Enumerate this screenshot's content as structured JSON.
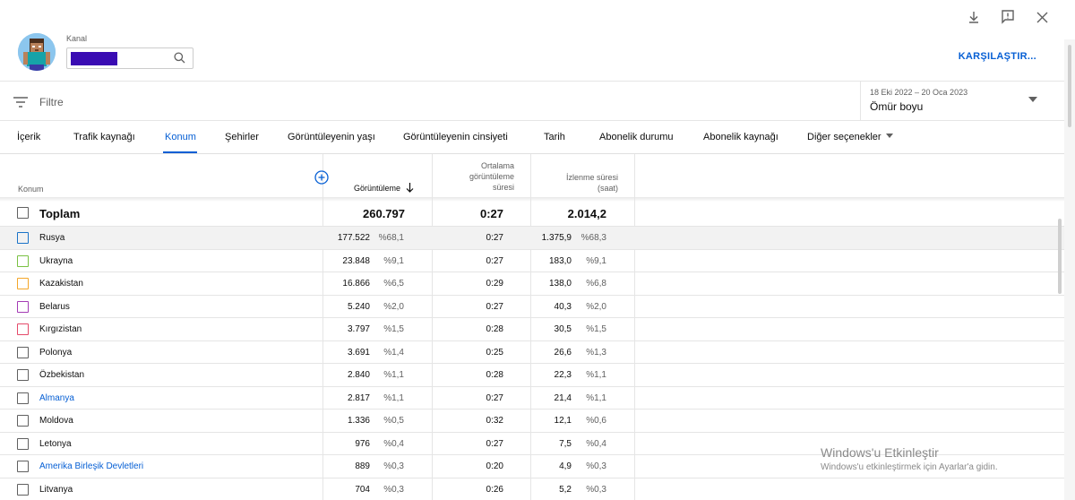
{
  "header": {
    "channel_label": "Kanal",
    "compare_button": "KARŞILAŞTIR...",
    "icons": [
      "download-icon",
      "feedback-icon",
      "close-icon"
    ]
  },
  "filter": {
    "placeholder": "Filtre",
    "date_range": "18 Eki 2022 – 20 Oca 2023",
    "period": "Ömür boyu"
  },
  "tabs": {
    "items": [
      "İçerik",
      "Trafik kaynağı",
      "Konum",
      "Şehirler",
      "Görüntüleyenin yaşı",
      "Görüntüleyenin cinsiyeti",
      "Tarih",
      "Abonelik durumu",
      "Abonelik kaynağı",
      "Diğer seçenekler"
    ],
    "active": "Konum"
  },
  "table": {
    "headers": {
      "location": "Konum",
      "views": "Görüntüleme",
      "avg_1": "Ortalama",
      "avg_2": "görüntüleme",
      "avg_3": "süresi",
      "watch_1": "İzlenme süresi",
      "watch_2": "(saat)"
    },
    "total": {
      "label": "Toplam",
      "views": "260.797",
      "avg": "0:27",
      "watch": "2.014,2"
    },
    "rows": [
      {
        "name": "Rusya",
        "views": "177.522",
        "views_pct": "%68,1",
        "avg": "0:27",
        "watch": "1.375,9",
        "watch_pct": "%68,3",
        "color": "#1a73c8"
      },
      {
        "name": "Ukrayna",
        "views": "23.848",
        "views_pct": "%9,1",
        "avg": "0:27",
        "watch": "183,0",
        "watch_pct": "%9,1",
        "color": "#79c142"
      },
      {
        "name": "Kazakistan",
        "views": "16.866",
        "views_pct": "%6,5",
        "avg": "0:29",
        "watch": "138,0",
        "watch_pct": "%6,8",
        "color": "#f4a629"
      },
      {
        "name": "Belarus",
        "views": "5.240",
        "views_pct": "%2,0",
        "avg": "0:27",
        "watch": "40,3",
        "watch_pct": "%2,0",
        "color": "#a43bb4"
      },
      {
        "name": "Kırgızistan",
        "views": "3.797",
        "views_pct": "%1,5",
        "avg": "0:28",
        "watch": "30,5",
        "watch_pct": "%1,5",
        "color": "#e44a6a"
      },
      {
        "name": "Polonya",
        "views": "3.691",
        "views_pct": "%1,4",
        "avg": "0:25",
        "watch": "26,6",
        "watch_pct": "%1,3",
        "color": "#606060"
      },
      {
        "name": "Özbekistan",
        "views": "2.840",
        "views_pct": "%1,1",
        "avg": "0:28",
        "watch": "22,3",
        "watch_pct": "%1,1",
        "color": "#606060"
      },
      {
        "name": "Almanya",
        "views": "2.817",
        "views_pct": "%1,1",
        "avg": "0:27",
        "watch": "21,4",
        "watch_pct": "%1,1",
        "color": "#606060",
        "link": true
      },
      {
        "name": "Moldova",
        "views": "1.336",
        "views_pct": "%0,5",
        "avg": "0:32",
        "watch": "12,1",
        "watch_pct": "%0,6",
        "color": "#606060"
      },
      {
        "name": "Letonya",
        "views": "976",
        "views_pct": "%0,4",
        "avg": "0:27",
        "watch": "7,5",
        "watch_pct": "%0,4",
        "color": "#606060"
      },
      {
        "name": "Amerika Birleşik Devletleri",
        "views": "889",
        "views_pct": "%0,3",
        "avg": "0:20",
        "watch": "4,9",
        "watch_pct": "%0,3",
        "color": "#606060",
        "link": true
      },
      {
        "name": "Litvanya",
        "views": "704",
        "views_pct": "%0,3",
        "avg": "0:26",
        "watch": "5,2",
        "watch_pct": "%0,3",
        "color": "#606060"
      }
    ]
  },
  "windows_watermark": {
    "title": "Windows'u Etkinleştir",
    "subtitle": "Windows'u etkinleştirmek için Ayarlar'a gidin."
  },
  "colors": {
    "accent": "#065fd4",
    "redaction": "#3a0cb3"
  }
}
